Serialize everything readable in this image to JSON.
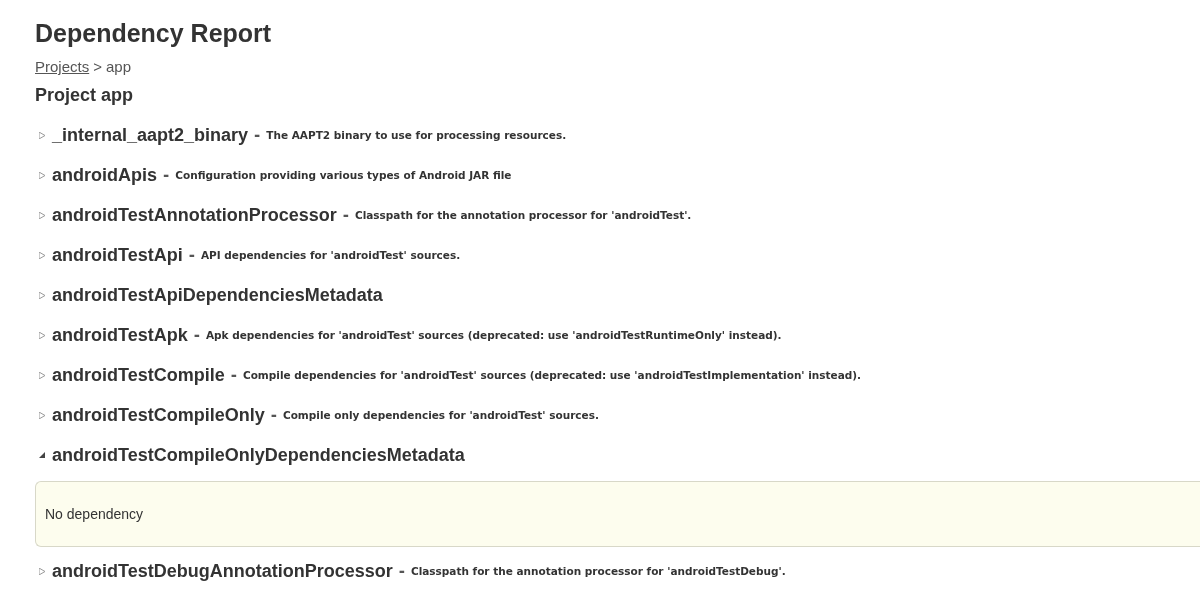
{
  "title": "Dependency Report",
  "breadcrumb": {
    "link": "Projects",
    "separator": ">",
    "current": "app"
  },
  "project_heading": "Project app",
  "configurations": [
    {
      "name": "_internal_aapt2_binary",
      "separator": "-",
      "description": "The AAPT2 binary to use for processing resources.",
      "expanded": false
    },
    {
      "name": "androidApis",
      "separator": "-",
      "description": "Configuration providing various types of Android JAR file",
      "expanded": false
    },
    {
      "name": "androidTestAnnotationProcessor",
      "separator": "-",
      "description": "Classpath for the annotation processor for 'androidTest'.",
      "expanded": false
    },
    {
      "name": "androidTestApi",
      "separator": "-",
      "description": "API dependencies for 'androidTest' sources.",
      "expanded": false
    },
    {
      "name": "androidTestApiDependenciesMetadata",
      "expanded": false
    },
    {
      "name": "androidTestApk",
      "separator": "-",
      "description": "Apk dependencies for 'androidTest' sources (deprecated: use 'androidTestRuntimeOnly' instead).",
      "expanded": false
    },
    {
      "name": "androidTestCompile",
      "separator": "-",
      "description": "Compile dependencies for 'androidTest' sources (deprecated: use 'androidTestImplementation' instead).",
      "expanded": false
    },
    {
      "name": "androidTestCompileOnly",
      "separator": "-",
      "description": "Compile only dependencies for 'androidTest' sources.",
      "expanded": false
    },
    {
      "name": "androidTestCompileOnlyDependenciesMetadata",
      "expanded": true,
      "content": "No dependency"
    },
    {
      "name": "androidTestDebugAnnotationProcessor",
      "separator": "-",
      "description": "Classpath for the annotation processor for 'androidTestDebug'.",
      "expanded": false
    }
  ]
}
